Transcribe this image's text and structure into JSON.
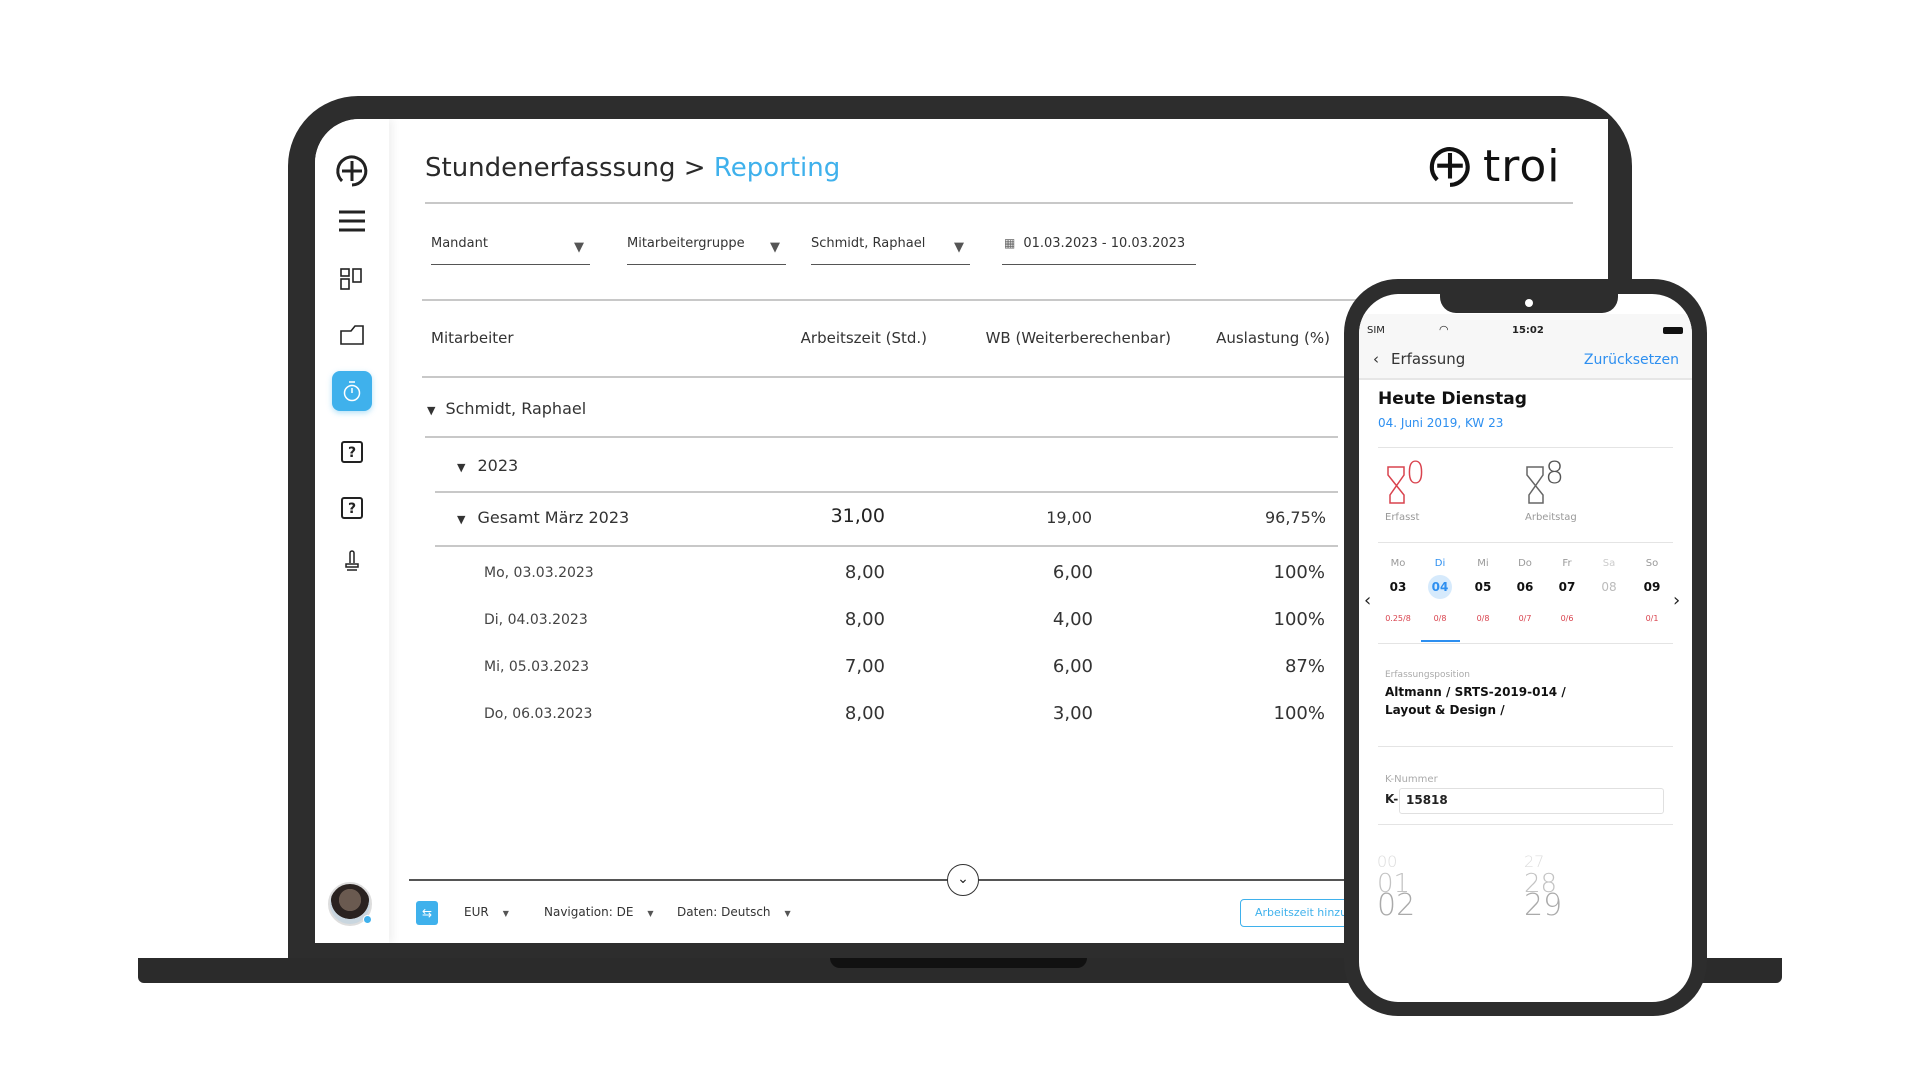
{
  "laptop": {
    "breadcrumb": {
      "parent": "Stundenerfasssung",
      "separator": ">",
      "current": "Reporting"
    },
    "logo": "troi",
    "sidebar": {
      "items": [
        "add-icon",
        "menu-icon",
        "dashboard-icon",
        "folder-icon",
        "stopwatch-icon",
        "help-icon",
        "help-icon",
        "stamp-icon"
      ],
      "active": "stopwatch-icon"
    },
    "filters": {
      "mandant": "Mandant",
      "gruppe": "Mitarbeitergruppe",
      "mitarbeiter": "Schmidt, Raphael",
      "daterange": "01.03.2023 - 10.03.2023"
    },
    "table": {
      "headers": [
        "Mitarbeiter",
        "Arbeitszeit (Std.)",
        "WB (Weiterberechenbar)",
        "Auslastung (%)"
      ],
      "employee": "Schmidt, Raphael",
      "year": "2023",
      "total": {
        "label": "Gesamt März 2023",
        "arbeitszeit": "31,00",
        "wb": "19,00",
        "auslastung": "96,75%"
      },
      "rows": [
        {
          "date": "Mo, 03.03.2023",
          "arbeitszeit": "8,00",
          "wb": "6,00",
          "auslastung": "100%"
        },
        {
          "date": "Di, 04.03.2023",
          "arbeitszeit": "8,00",
          "wb": "4,00",
          "auslastung": "100%"
        },
        {
          "date": "Mi, 05.03.2023",
          "arbeitszeit": "7,00",
          "wb": "6,00",
          "auslastung": "87%"
        },
        {
          "date": "Do, 06.03.2023",
          "arbeitszeit": "8,00",
          "wb": "3,00",
          "auslastung": "100%"
        }
      ]
    },
    "footer": {
      "currency": "EUR",
      "navigation": "Navigation: DE",
      "daten": "Daten: Deutsch",
      "button": "Arbeitszeit hinzu"
    },
    "accent": "#3fb1ec"
  },
  "phone": {
    "status": {
      "carrier": "SIM",
      "time": "15:02"
    },
    "nav": {
      "back": "Erfassung",
      "action": "Zurücksetzen"
    },
    "heading": "Heute Dienstag",
    "date": "04. Juni 2019, KW 23",
    "erfasst": {
      "value": "0",
      "label": "Erfasst"
    },
    "arbeitstag": {
      "value": "8",
      "label": "Arbeitstag"
    },
    "week": [
      {
        "wd": "Mo",
        "num": "03",
        "ratio": "0.25/8"
      },
      {
        "wd": "Di",
        "num": "04",
        "ratio": "0/8"
      },
      {
        "wd": "Mi",
        "num": "05",
        "ratio": "0/8"
      },
      {
        "wd": "Do",
        "num": "06",
        "ratio": "0/7"
      },
      {
        "wd": "Fr",
        "num": "07",
        "ratio": "0/6"
      },
      {
        "wd": "Sa",
        "num": "08",
        "ratio": ""
      },
      {
        "wd": "So",
        "num": "09",
        "ratio": "0/1"
      }
    ],
    "selected_day": "04",
    "position": {
      "label": "Erfassungsposition",
      "line1": "Altmann / SRTS-2019-014 /",
      "line2": "Layout & Design /"
    },
    "knummer": {
      "label": "K-Nummer",
      "prefix": "K-",
      "value": "15818"
    },
    "picker": {
      "hours": [
        "00",
        "01",
        "02"
      ],
      "minutes": [
        "27",
        "28",
        "29"
      ]
    },
    "red": "#d9434e"
  }
}
